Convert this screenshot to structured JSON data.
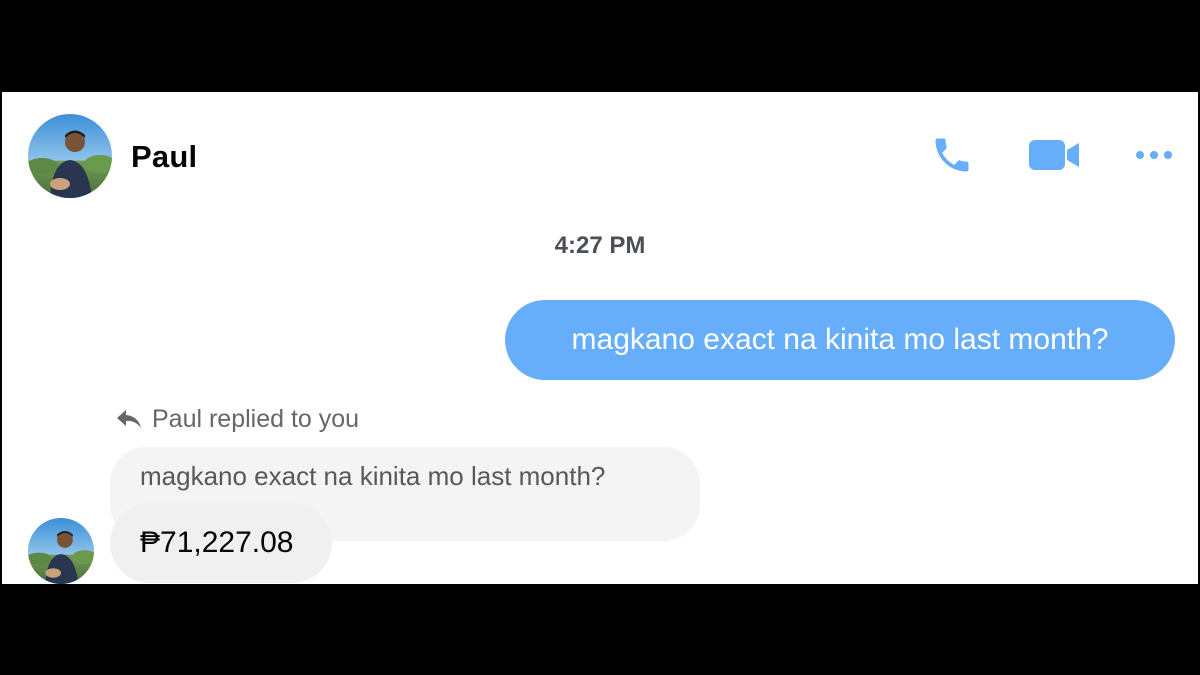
{
  "contact": {
    "name": "Paul",
    "avatar_icon": "profile-photo"
  },
  "header": {
    "call_icon": "phone-icon",
    "video_icon": "video-camera-icon",
    "more_icon": "more-dots-icon",
    "accent_color": "#66aef9"
  },
  "conversation": {
    "timestamp": "4:27 PM",
    "outgoing_message": "magkano exact na kinita mo last month?",
    "reply_label": "Paul replied to you",
    "reply_icon": "reply-arrow-icon",
    "quoted_message": "magkano exact na kinita mo last month?",
    "incoming_message": "₱71,227.08"
  }
}
